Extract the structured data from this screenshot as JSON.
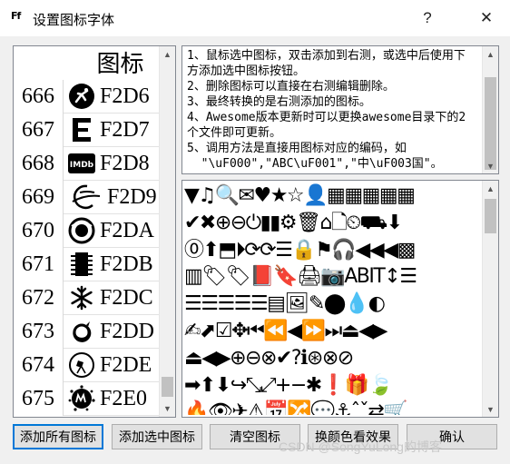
{
  "window": {
    "title": "设置图标字体",
    "app_icon": "Ff",
    "help_symbol": "?",
    "close_symbol": "✕"
  },
  "list": {
    "header": "图标",
    "rows": [
      {
        "num": "666",
        "code": "F2D6",
        "icon": "swimmer-icon"
      },
      {
        "num": "667",
        "code": "F2D7",
        "icon": "letter-e-icon"
      },
      {
        "num": "668",
        "code": "F2D8",
        "icon": "imdb-icon",
        "icon_text": "IMDb"
      },
      {
        "num": "669",
        "code": "F2D9",
        "icon": "ravelry-icon"
      },
      {
        "num": "670",
        "code": "F2DA",
        "icon": "eercast-icon"
      },
      {
        "num": "671",
        "code": "F2DB",
        "icon": "microchip-icon"
      },
      {
        "num": "672",
        "code": "F2DC",
        "icon": "snowflake-icon"
      },
      {
        "num": "673",
        "code": "F2DD",
        "icon": "superpowers-icon"
      },
      {
        "num": "674",
        "code": "F2DE",
        "icon": "wpexplorer-icon"
      },
      {
        "num": "675",
        "code": "F2E0",
        "icon": "meetup-icon"
      }
    ]
  },
  "tips": {
    "lines": [
      "1、鼠标选中图标，双击添加到右测，或选中后使用下方添加选中图标按钮。",
      "2、删除图标可以直接在右测编辑删除。",
      "3、最终转换的是右测添加的图标。",
      "4、Awesome版本更新时可以更换awesome目录下的2个文件即可更新。",
      "5、调用方法是直接用图标对应的编码，如\n  \"\\uF000\",\"ABC\\uF001\",\"中\\uF003国\"。"
    ]
  },
  "icon_grid": {
    "rows": [
      "▼♫🔍✉♥★☆👤▦▦▦▦▦",
      "✔✖⊕⊖⏻▮▮⚙🗑⌂🗋⏲⛟⬇",
      "⓪⬆⬒⏵⟳⟳☰🔒⚑🎧◀◀◀▩",
      "▥🏷🏷📕🔖🖨📷ABIT↕☰",
      "☰☰☰☰☰▤🖼✎⬤💧◐",
      "✍⬈☑✥⏮⏪◀⏩⏭⏏◀▶",
      "⏏◀▶⊕⊖⊗✔?ℹ⊛⊗⊘",
      "➡⬆⬇↪⤡⤢+−✱❗🎁🍃",
      "🔥👁✈⚠📅🔀💬⚓ˆˇ⇄🛒",
      "📁📂↕↔▥📊⚙💬💬★"
    ]
  },
  "buttons": {
    "add_all": "添加所有图标",
    "add_selected": "添加选中图标",
    "clear": "清空图标",
    "change_color": "换颜色看效果",
    "confirm": "确认"
  },
  "watermark": "CSDN @SongYuLong的博客"
}
